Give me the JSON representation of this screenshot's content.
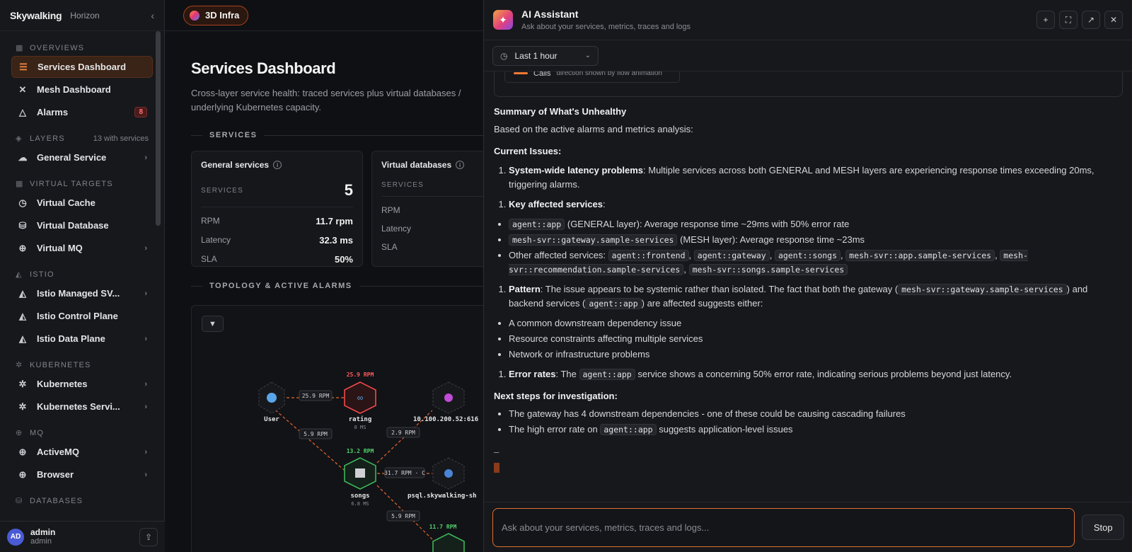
{
  "brand": {
    "logo": "Skywalking",
    "product": "Horizon"
  },
  "sidebar": {
    "groups": [
      {
        "label": "OVERVIEWS",
        "items": [
          {
            "label": "Services Dashboard",
            "active": true
          },
          {
            "label": "Mesh Dashboard"
          },
          {
            "label": "Alarms",
            "badge": "8"
          }
        ]
      },
      {
        "label": "LAYERS",
        "count": "13 with services",
        "items": [
          {
            "label": "General Service"
          }
        ]
      },
      {
        "label": "VIRTUAL TARGETS",
        "items": [
          {
            "label": "Virtual Cache"
          },
          {
            "label": "Virtual Database"
          },
          {
            "label": "Virtual MQ"
          }
        ]
      },
      {
        "label": "ISTIO",
        "items": [
          {
            "label": "Istio Managed SV..."
          },
          {
            "label": "Istio Control Plane"
          },
          {
            "label": "Istio Data Plane"
          }
        ]
      },
      {
        "label": "KUBERNETES",
        "items": [
          {
            "label": "Kubernetes"
          },
          {
            "label": "Kubernetes Servi..."
          }
        ]
      },
      {
        "label": "MQ",
        "items": [
          {
            "label": "ActiveMQ"
          },
          {
            "label": "Browser"
          }
        ]
      },
      {
        "label": "DATABASES",
        "items": []
      }
    ],
    "user": {
      "initials": "AD",
      "name": "admin",
      "role": "admin"
    }
  },
  "main": {
    "pill": "3D Infra",
    "title": "Services Dashboard",
    "desc_line1": "Cross-layer service health: traced services plus virtual databases /",
    "desc_line2": "underlying Kubernetes capacity.",
    "section_services": "SERVICES",
    "section_topology": "TOPOLOGY & ACTIVE ALARMS",
    "cards": [
      {
        "title": "General services",
        "svc_label": "SERVICES",
        "svc_count": "5",
        "rows": [
          {
            "k": "RPM",
            "v": "11.7 rpm"
          },
          {
            "k": "Latency",
            "v": "32.3 ms"
          },
          {
            "k": "SLA",
            "v": "50%"
          }
        ]
      },
      {
        "title": "Virtual databases",
        "svc_label": "SERVICES",
        "svc_count": "",
        "rows": [
          {
            "k": "RPM",
            "v": ""
          },
          {
            "k": "Latency",
            "v": ""
          },
          {
            "k": "SLA",
            "v": ""
          }
        ]
      }
    ],
    "topology": {
      "nodes": [
        {
          "id": "user",
          "label": "User",
          "rpm": "",
          "ms": ""
        },
        {
          "id": "rating",
          "label": "rating",
          "rpm": "25.9 RPM",
          "ms": "0 MS"
        },
        {
          "id": "ip",
          "label": "10.100.200.52:616",
          "rpm": "",
          "ms": ""
        },
        {
          "id": "songs",
          "label": "songs",
          "rpm": "13.2 RPM",
          "ms": "6.8 MS"
        },
        {
          "id": "psql",
          "label": "psql.skywalking-sh",
          "rpm": "",
          "ms": ""
        },
        {
          "id": "n6",
          "label": "",
          "rpm": "11.7 RPM",
          "ms": ""
        }
      ],
      "edges": [
        {
          "label": "25.9 RPM"
        },
        {
          "label": "5.9 RPM"
        },
        {
          "label": "2.9 RPM"
        },
        {
          "label": "31.7 RPM · C"
        },
        {
          "label": "5.9 RPM"
        }
      ]
    }
  },
  "assistant": {
    "title": "AI Assistant",
    "subtitle": "Ask about your services, metrics, traces and logs",
    "time_range": "Last 1 hour",
    "legend_label": "Calls",
    "legend_note": "direction shown by flow animation",
    "summary_title": "Summary of What's Unhealthy",
    "summary_intro": "Based on the active alarms and metrics analysis:",
    "current_issues": "Current Issues:",
    "issue1_title": "System-wide latency problems",
    "issue1_text": ": Multiple services across both GENERAL and MESH layers are experiencing response times exceeding 20ms, triggering alarms.",
    "issue2_title": "Key affected services",
    "affected": {
      "a1_code": "agent::app",
      "a1_text": " (GENERAL layer): Average response time ~29ms with 50% error rate",
      "a2_code": "mesh-svr::gateway.sample-services",
      "a2_text": " (MESH layer): Average response time ~23ms",
      "a3_prefix": "Other affected services: ",
      "a3_codes": [
        "agent::frontend",
        "agent::gateway",
        "agent::songs",
        "mesh-svr::app.sample-services",
        "mesh-svr::recommendation.sample-services",
        "mesh-svr::songs.sample-services"
      ]
    },
    "issue3_title": "Pattern",
    "issue3_text_a": ": The issue appears to be systemic rather than isolated. The fact that both the gateway (",
    "issue3_code_a": "mesh-svr::gateway.sample-services",
    "issue3_text_b": ") and backend services (",
    "issue3_code_b": "agent::app",
    "issue3_text_c": ") are affected suggests either:",
    "pattern_list": [
      "A common downstream dependency issue",
      "Resource constraints affecting multiple services",
      "Network or infrastructure problems"
    ],
    "issue4_title": "Error rates",
    "issue4_text_a": ": The ",
    "issue4_code": "agent::app",
    "issue4_text_b": " service shows a concerning 50% error rate, indicating serious problems beyond just latency.",
    "next_title": "Next steps for investigation:",
    "next1": "The gateway has 4 downstream dependencies - one of these could be causing cascading failures",
    "next2_a": "The high error rate on ",
    "next2_code": "agent::app",
    "next2_b": " suggests application-level issues",
    "input_placeholder": "Ask about your services, metrics, traces and logs...",
    "stop_label": "Stop"
  }
}
